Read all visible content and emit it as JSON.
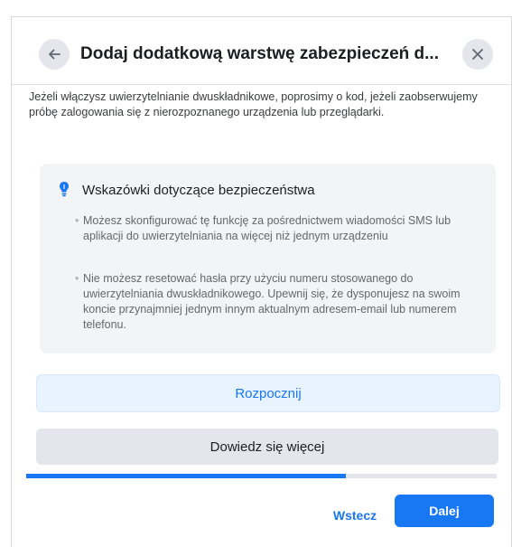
{
  "dialog": {
    "title": "Dodaj dodatkową warstwę zabezpieczeń d...",
    "intro": "Jeżeli włączysz uwierzytelnianie dwuskładnikowe, poprosimy o kod, jeżeli zaobserwujemy próbę zalogowania się z nierozpoznanego urządzenia lub przeglądarki."
  },
  "tips": {
    "heading": "Wskazówki dotyczące bezpieczeństwa",
    "items": [
      {
        "text": "Możesz skonfigurować tę funkcję za pośrednictwem wiadomości SMS lub aplikacji do uwierzytelniania na więcej niż jednym urządzeniu"
      },
      {
        "text": "Nie możesz resetować hasła przy użyciu numeru stosowanego do uwierzytelniania dwuskładnikowego. Upewnij się, że dysponujesz na swoim koncie przynajmniej jednym innym aktualnym adresem-email lub numerem telefonu."
      }
    ],
    "bullet": "•"
  },
  "buttons": {
    "start": "Rozpocznij",
    "learn_more": "Dowiedz się więcej",
    "back": "Wstecz",
    "next": "Dalej"
  },
  "progress": {
    "fraction": 0.68
  },
  "colors": {
    "accent": "#1877f2",
    "accent_light": "#e7f3ff",
    "tip_icon": "#1877f2"
  },
  "icons": {
    "back": "arrow-left-icon",
    "close": "close-icon",
    "tips": "lightbulb-icon"
  }
}
